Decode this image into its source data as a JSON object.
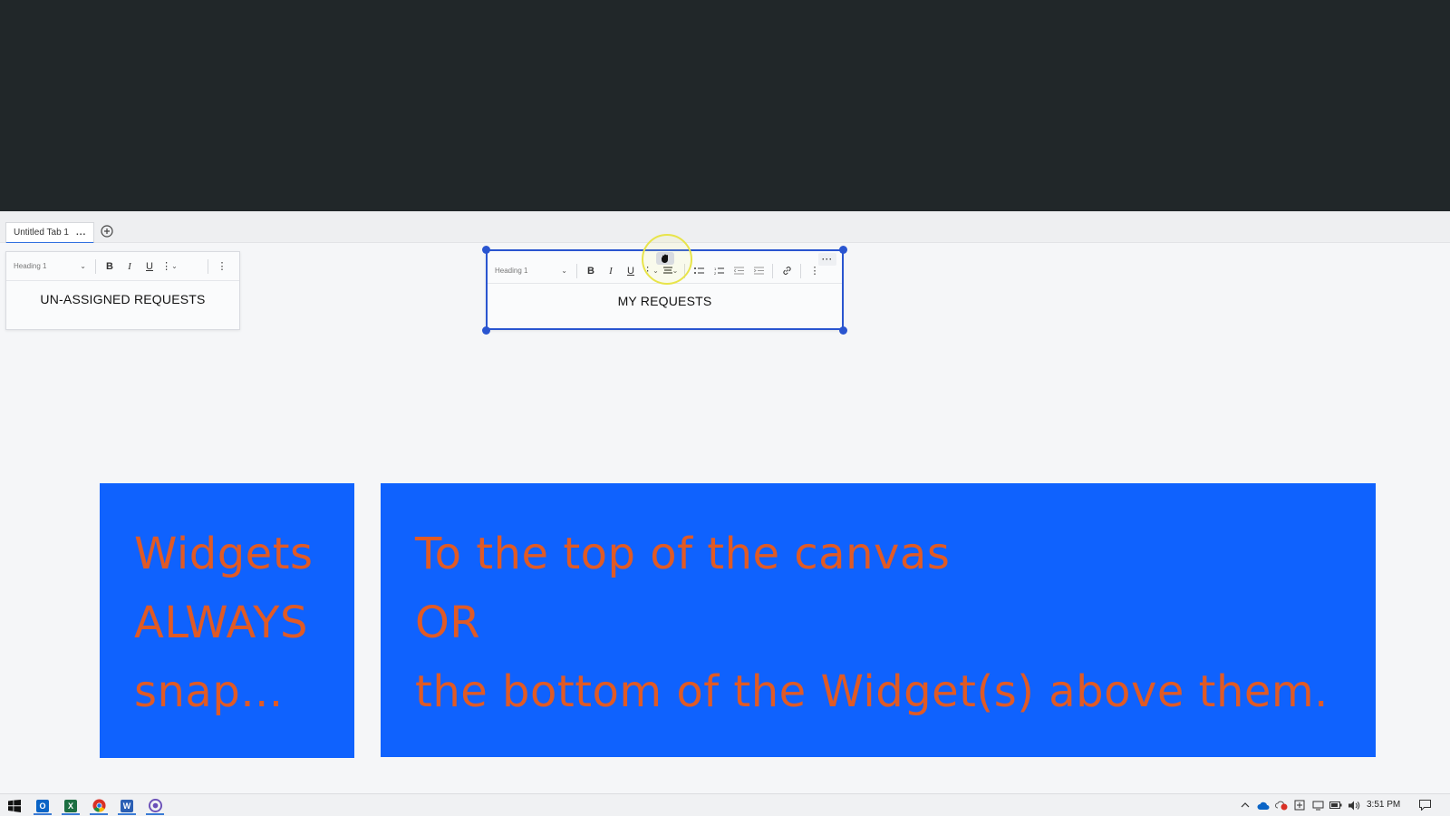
{
  "tabs": [
    {
      "label": "Untitled Tab 1",
      "more": "..."
    }
  ],
  "widgets": {
    "unassigned": {
      "style_label": "Heading 1",
      "title": "UN-ASSIGNED REQUESTS"
    },
    "my_requests": {
      "style_label": "Heading 1",
      "title": "MY REQUESTS",
      "more": "···"
    }
  },
  "notes": {
    "left": "Widgets\nALWAYS\nsnap...",
    "right": "To the top of the canvas\nOR\nthe bottom of the Widget(s) above them."
  },
  "taskbar": {
    "apps": [
      {
        "name": "outlook",
        "glyph": "O",
        "color": "#0a64c6"
      },
      {
        "name": "excel",
        "glyph": "X",
        "color": "#1d6f42"
      },
      {
        "name": "chrome",
        "glyph": "",
        "color": "#e0a81d"
      },
      {
        "name": "word",
        "glyph": "W",
        "color": "#2b5fb4"
      },
      {
        "name": "other",
        "glyph": "",
        "color": "#6a4fb8"
      }
    ],
    "clock": "3:51 PM"
  },
  "colors": {
    "accent": "#2a55d0",
    "note_bg": "#0f62fe",
    "note_text": "#e05a25",
    "dark": "#212729"
  }
}
